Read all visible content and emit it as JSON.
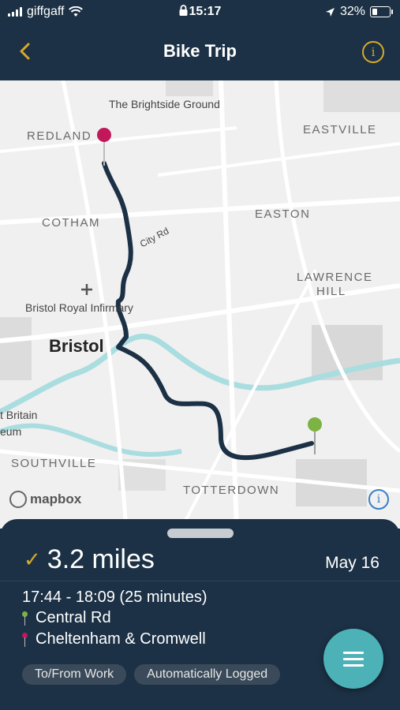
{
  "status_bar": {
    "carrier": "giffgaff",
    "time": "15:17",
    "battery_percent": "32%",
    "battery_level": 0.32
  },
  "header": {
    "title": "Bike Trip",
    "back_icon": "chevron-left-icon",
    "info_icon": "info-circle-icon",
    "accent_color": "#d9a92a"
  },
  "map": {
    "labels": {
      "brightside": "The Brightside Ground",
      "redland": "REDLAND",
      "eastville": "EASTVILLE",
      "easton": "EASTON",
      "cotham": "COTHAM",
      "city_rd": "City Rd",
      "lawrence_hill_1": "LAWRENCE",
      "lawrence_hill_2": "HILL",
      "infirmary": "Bristol Royal Infirmary",
      "bristol": "Bristol",
      "britain": "t Britain",
      "eum": "eum",
      "southville": "SOUTHVILLE",
      "totterdown": "TOTTERDOWN"
    },
    "attribution": "mapbox",
    "route_color": "#1c3145",
    "start_pin_color": "#c2185b",
    "end_pin_color": "#7cb342"
  },
  "trip": {
    "distance": "3.2 miles",
    "date": "May 16",
    "time_range": "17:44 - 18:09 (25 minutes)",
    "start_location": "Central Rd",
    "end_location": "Cheltenham & Cromwell",
    "tags": [
      "To/From Work",
      "Automatically Logged"
    ]
  },
  "fab_icon": "menu-icon",
  "fab_color": "#4db1b8"
}
